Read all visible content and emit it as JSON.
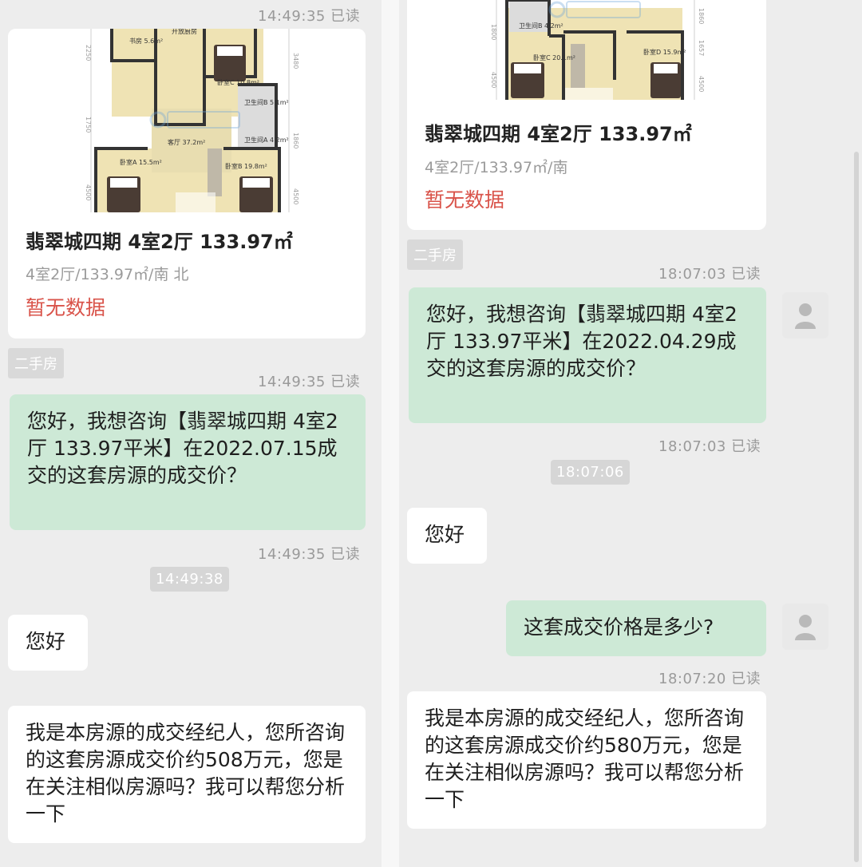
{
  "left": {
    "ts_top": "14:49:35 已读",
    "listing": {
      "title": "翡翠城四期 4室2厅 133.97㎡",
      "sub": "4室2厅/133.97㎡/南 北",
      "status": "暂无数据",
      "rooms": [
        "书房 5.6m²",
        "开放厨房",
        "卧室C 10.8m²",
        "卫生间B 5.1m²",
        "客厅 37.2m²",
        "卫生间A 4.2m²",
        "卧室A 15.5m²",
        "卧室B 19.8m²"
      ]
    },
    "tag": "二手房",
    "ts_after_tag": "14:49:35 已读",
    "message_out": "您好，我想咨询【翡翠城四期 4室2厅 133.97平米】在2022.07.15成交的这套房源的成交价？",
    "ts_after_msg": "14:49:35 已读",
    "time_pill": "14:49:38",
    "reply_hello": "您好",
    "reply_price": "我是本房源的成交经纪人，您所咨询的这套房源成交价约508万元，您是在关注相似房源吗？我可以帮您分析一下"
  },
  "right": {
    "listing": {
      "title": "翡翠城四期 4室2厅 133.97㎡",
      "sub": "4室2厅/133.97㎡/南",
      "status": "暂无数据",
      "rooms": [
        "卫生间B 4.2m²",
        "卧室C 20.1m²",
        "卧室D 15.9m²"
      ]
    },
    "tag": "二手房",
    "ts_after_tag": "18:07:03 已读",
    "message_out": "您好，我想咨询【翡翠城四期 4室2厅 133.97平米】在2022.04.29成交的这套房源的成交价？",
    "ts_after_msg": "18:07:03 已读",
    "time_pill": "18:07:06",
    "reply_hello": "您好",
    "message_out2": "这套成交价格是多少?",
    "ts_after_msg2": "18:07:20 已读",
    "reply_price": "我是本房源的成交经纪人，您所咨询的这套房源成交价约580万元，您是在关注相似房源吗？我可以帮您分析一下"
  },
  "colors": {
    "bubble_green": "#cde9d6",
    "status_red": "#d9534a",
    "timestamp_gray": "#9a9a9a"
  },
  "icons": {
    "avatar": "user-placeholder-icon",
    "plan": "floor-plan-image"
  }
}
